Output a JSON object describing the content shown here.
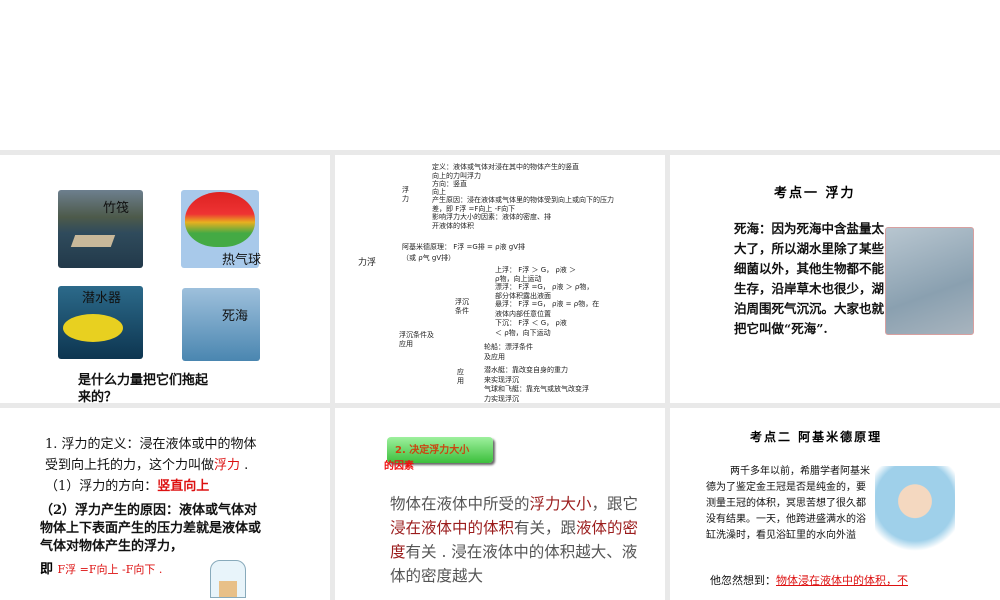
{
  "slides": [
    {
      "labels": [
        "竹筏",
        "热气球",
        "潜水器",
        "死海"
      ],
      "question_l1": "是什么力量把它们拖起",
      "question_l2": "来的？"
    },
    {
      "root": "力浮",
      "branch1": "浮\n力",
      "def1": "定义：液体或气体对浸在其中的物体产生的竖直",
      "def2": "向上的力叫浮力",
      "dir1": "方向：竖直",
      "dir2": "向上",
      "cause1": "产生原因：浸在液体或气体里的物体受到向上或向下的压力",
      "cause2": "差，即 F浮 =F向上 -F向下",
      "factor1": "影响浮力大小的因素：液体的密度、排",
      "factor2": "开液体的体积",
      "arch1": "阿基米德原理：   F浮 =G排 = ρ液 gV排",
      "arch2": "（或 ρ气 gV排）",
      "sink_app": "浮沉条件及\n应用",
      "cond": "浮沉\n条件",
      "up1": "上浮：  F浮 ＞ G，  ρ液 ＞",
      "up2": "ρ物，向上运动",
      "float1": "漂浮：  F浮 =G，  ρ液 ＞ ρ物，",
      "float2": "部分体积露出液面",
      "susp1": "悬浮：  F浮 =G，  ρ液 = ρ物，在",
      "susp2": "液体内部任意位置",
      "down1": "下沉：  F浮 ＜ G，  ρ液",
      "down2": "＜ ρ物，向下运动",
      "app": "应\n用",
      "ship1": "轮船：漂浮条件",
      "ship2": "及应用",
      "sub1": "潜水艇：靠改变自身的重力",
      "sub2": "来实现浮沉",
      "balloon1": "气球和飞艇：靠充气或放气改变浮",
      "balloon2": "力实现浮沉"
    },
    {
      "title": "考点一   浮力",
      "lead": "死海：",
      "body": "因为死海中含盐量太大了，所以湖水里除了某些细菌以外，其他生物都不能生存，沿岸草木也很少，湖泊周围死气沉沉。大家也就把它叫做“死海”."
    },
    {
      "l1": "1. 浮力的定义：浸在液体或中的物体",
      "l2a": "受到向上托的力，这个力叫做",
      "l2b": "浮力",
      "l2c": " .",
      "l3a": "（1）浮力的方向：",
      "l3b": "竖直向上",
      "l4": "（2）浮力产生的原因：液体或气体对物体上下表面产生的压力差就是液体或气体对物体产生的浮力，",
      "l5a": "即 ",
      "formula": "F浮 =F向上 -F向下 ."
    },
    {
      "button": "2. 决定浮力大小",
      "button2": "的因素",
      "t1": "物体在液体中所受的",
      "t2": "浮力大小",
      "t3": "，跟它",
      "t4": "浸在液体中的体积",
      "t5": "有关，跟",
      "t6": "液体的密度",
      "t7": "有关 . 浸在液体中的体积越大、液体的密度越大"
    },
    {
      "title": "考点二   阿基米德原理",
      "p1": "两千多年以前，希腊学者阿基米德为了鉴定金王冠是否是纯金的，要测量王冠的体积，冥思苦想了很久都没有结果。一天，他跨进盛满水的浴缸洗澡时，看见浴缸里的水向外溢",
      "p2a": "他忽然想到：",
      "p2b": "物体浸在液体中的体积，不"
    }
  ]
}
